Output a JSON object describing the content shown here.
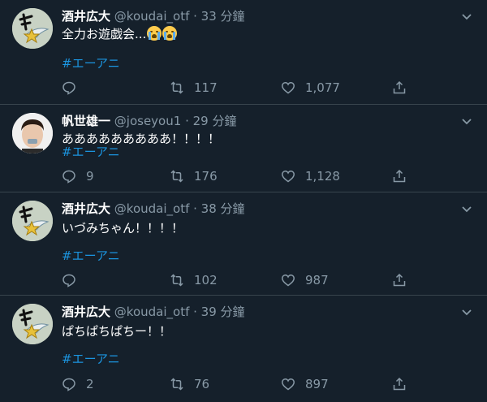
{
  "tweets": [
    {
      "name": "酒井広大",
      "handle": "@koudai_otf",
      "time": "· 33 分鐘",
      "text": "全力お遊戯会...",
      "emojis": [
        "loudly-crying-face",
        "loudly-crying-face"
      ],
      "hashtag": "#エーアニ",
      "replies": "",
      "retweets": "117",
      "likes": "1,077",
      "avatar": "star-wing-avatar"
    },
    {
      "name": "帆世雄一",
      "handle": "@joseyou1",
      "time": "· 29 分鐘",
      "text": "あああああああああ！！！！",
      "emojis": [],
      "hashtag": "#エーアニ",
      "replies": "9",
      "retweets": "176",
      "likes": "1,128",
      "avatar": "photo-avatar"
    },
    {
      "name": "酒井広大",
      "handle": "@koudai_otf",
      "time": "· 38 分鐘",
      "text": "いづみちゃん！！！！",
      "emojis": [],
      "hashtag": "#エーアニ",
      "replies": "",
      "retweets": "102",
      "likes": "987",
      "avatar": "star-wing-avatar"
    },
    {
      "name": "酒井広大",
      "handle": "@koudai_otf",
      "time": "· 39 分鐘",
      "text": "ぱちぱちぱちー！！",
      "emojis": [],
      "hashtag": "#エーアニ",
      "replies": "2",
      "retweets": "76",
      "likes": "897",
      "avatar": "star-wing-avatar"
    }
  ],
  "colors": {
    "background": "#15202b",
    "divider": "#38444d",
    "secondary_text": "#8899a6",
    "hashtag": "#1b95e0"
  }
}
